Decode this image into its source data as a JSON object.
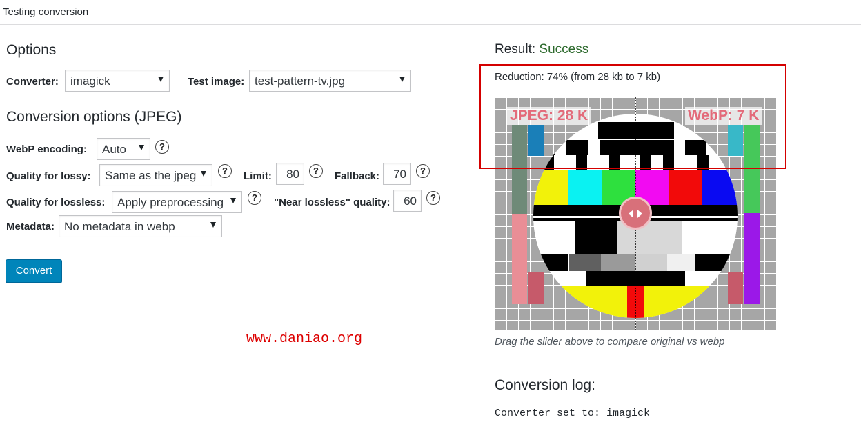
{
  "page": {
    "title": "Testing conversion"
  },
  "options": {
    "heading": "Options",
    "converter_label": "Converter:",
    "converter_value": "imagick",
    "test_image_label": "Test image:",
    "test_image_value": "test-pattern-tv.jpg"
  },
  "conversion": {
    "heading": "Conversion options (JPEG)",
    "webp_encoding_label": "WebP encoding:",
    "webp_encoding_value": "Auto",
    "quality_lossy_label": "Quality for lossy:",
    "quality_lossy_value": "Same as the jpeg",
    "limit_label": "Limit:",
    "limit_value": "80",
    "fallback_label": "Fallback:",
    "fallback_value": "70",
    "quality_lossless_label": "Quality for lossless:",
    "quality_lossless_value": "Apply preprocessing",
    "near_lossless_label": "\"Near lossless\" quality:",
    "near_lossless_value": "60",
    "metadata_label": "Metadata:",
    "metadata_value": "No metadata in webp",
    "help_glyph": "?",
    "convert_label": "Convert"
  },
  "watermark": "www.daniao.org",
  "result": {
    "label": "Result:",
    "status": "Success",
    "reduction": "Reduction: 74% (from 28 kb to 7 kb)",
    "jpeg_size": "JPEG: 28 K",
    "webp_size": "WebP: 7 K",
    "caption": "Drag the slider above to compare original vs webp",
    "slider_position_fraction": 0.5
  },
  "log": {
    "title": "Conversion log:",
    "lines": [
      "Converter set to: imagick"
    ]
  },
  "colors": {
    "accent_button": "#0085ba",
    "success": "#2d6a2d",
    "highlight_box": "#d40000",
    "watermark": "#dd0000",
    "size_label": "#e36a7a",
    "slider_handle": "#d8707a"
  }
}
